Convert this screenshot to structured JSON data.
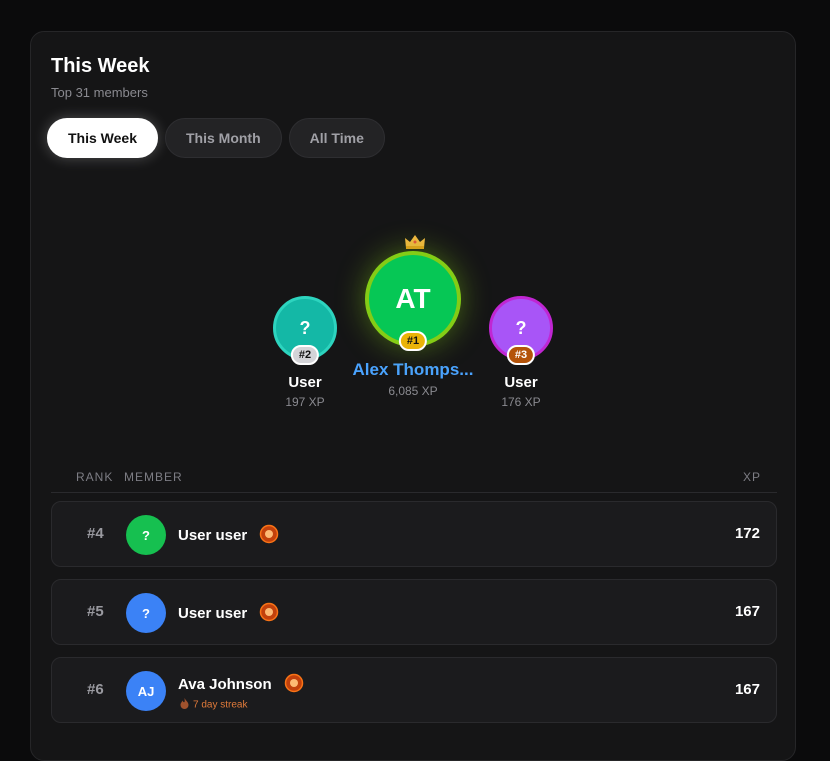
{
  "header": {
    "title": "This Week",
    "subtitle": "Top 31 members"
  },
  "tabs": [
    {
      "label": "This Week",
      "active": true
    },
    {
      "label": "This Month",
      "active": false
    },
    {
      "label": "All Time",
      "active": false
    }
  ],
  "podium": [
    {
      "place": "#2",
      "initials": "?",
      "name": "User",
      "xp": "197 XP",
      "color": "#14b8a6",
      "ring": "#2dd4bf",
      "badge_bg": "#d4d4d8"
    },
    {
      "place": "#1",
      "initials": "AT",
      "name": "Alex Thomps...",
      "xp": "6,085 XP",
      "color": "#06c755",
      "ring": "#84cc16",
      "badge_bg": "#eab308",
      "crown": "crown-icon"
    },
    {
      "place": "#3",
      "initials": "?",
      "name": "User",
      "xp": "176 XP",
      "color": "#a855f7",
      "ring": "#c026d3",
      "badge_bg": "#b45309"
    }
  ],
  "table": {
    "headers": {
      "rank": "RANK",
      "member": "MEMBER",
      "xp": "XP"
    },
    "rows": [
      {
        "rank": "#4",
        "initials": "?",
        "name": "User user",
        "xp": "172",
        "color": "#16c050",
        "badge": "medal-icon"
      },
      {
        "rank": "#5",
        "initials": "?",
        "name": "User user",
        "xp": "167",
        "color": "#3b82f6",
        "badge": "medal-icon"
      },
      {
        "rank": "#6",
        "initials": "AJ",
        "name": "Ava Johnson",
        "xp": "167",
        "color": "#3b82f6",
        "badge": "medal-icon",
        "streak": "7 day streak",
        "streak_icon": "fire-icon"
      }
    ]
  },
  "colors": {
    "accent_name": "#4aa3ff",
    "streak": "#e07a3a"
  }
}
